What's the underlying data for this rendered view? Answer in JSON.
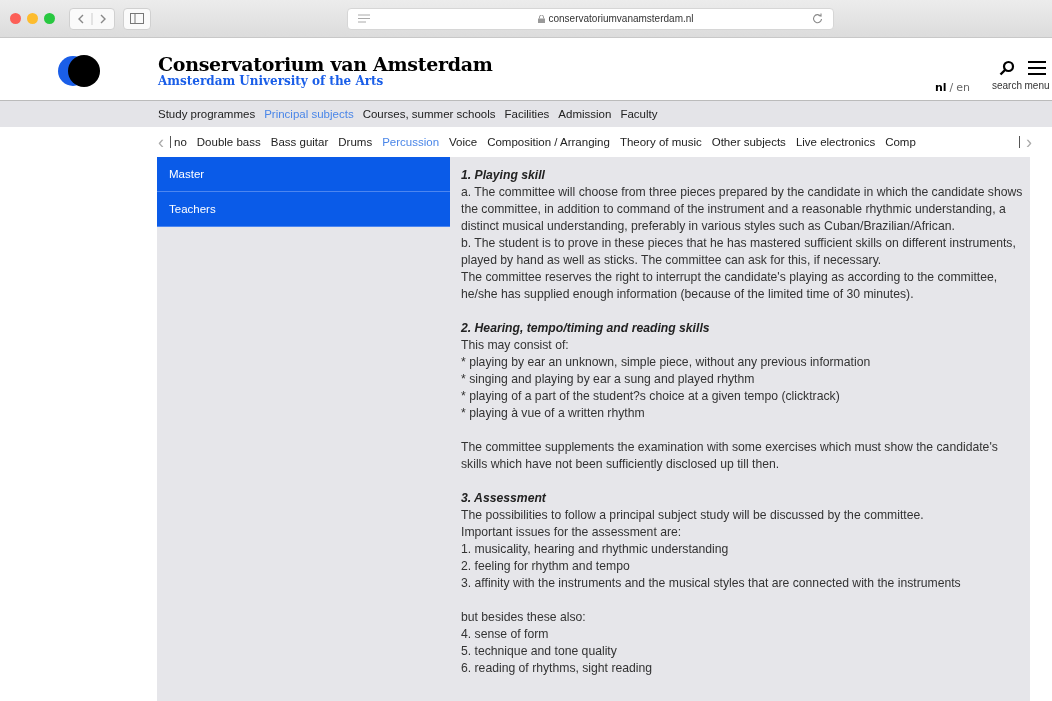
{
  "browser": {
    "url": "conservatoriumvanamsterdam.nl"
  },
  "header": {
    "title": "Conservatorium van Amsterdam",
    "subtitle": "Amsterdam University of the Arts",
    "languages": [
      {
        "label": "nl",
        "selected": true
      },
      {
        "label": "/",
        "selected": false
      },
      {
        "label": "en",
        "selected": false
      }
    ],
    "search_label": "search",
    "menu_label": "menu"
  },
  "nav": [
    {
      "label": "Study programmes",
      "selected": false
    },
    {
      "label": "Principal subjects",
      "selected": true
    },
    {
      "label": "Courses, summer schools",
      "selected": false
    },
    {
      "label": "Facilities",
      "selected": false
    },
    {
      "label": "Admission",
      "selected": false
    },
    {
      "label": "Faculty",
      "selected": false
    }
  ],
  "subjects": {
    "prev": "‹",
    "next": "›",
    "items": [
      {
        "label": "no",
        "selected": false
      },
      {
        "label": "Double bass",
        "selected": false
      },
      {
        "label": "Bass guitar",
        "selected": false
      },
      {
        "label": "Drums",
        "selected": false
      },
      {
        "label": "Percussion",
        "selected": true
      },
      {
        "label": "Voice",
        "selected": false
      },
      {
        "label": "Composition / Arranging",
        "selected": false
      },
      {
        "label": "Theory of music",
        "selected": false
      },
      {
        "label": "Other subjects",
        "selected": false
      },
      {
        "label": "Live electronics",
        "selected": false
      },
      {
        "label": "Comp",
        "selected": false
      }
    ]
  },
  "sidebar": {
    "items": [
      "Master",
      "Teachers"
    ]
  },
  "content": [
    {
      "heading": "1. Playing skill",
      "groups": [
        [
          "a. The committee will choose from three pieces prepared by the candidate in which the candidate shows the committee, in addition to command of the instrument and a reasonable rhythmic understanding, a distinct musical understanding, preferably in various styles such as Cuban/Brazilian/African.",
          "b. The student is to prove in these pieces that he has mastered sufficient skills on different instruments, played by hand as well as sticks. The committee can ask for this, if necessary.",
          "The committee reserves the right to interrupt the candidate's playing as according to the committee, he/she has supplied enough information (because of the limited time of 30 minutes)."
        ]
      ]
    },
    {
      "heading": "2. Hearing, tempo/timing and reading skills",
      "groups": [
        [
          "This may consist of:",
          "* playing by ear an unknown, simple piece, without any previous information",
          "* singing and playing by ear a sung and played rhythm",
          "* playing of a part of the student?s choice at a given tempo (clicktrack)",
          "* playing à vue of  a written rhythm"
        ],
        [
          "The committee supplements the examination with some exercises which must show the candidate's skills which have not been sufficiently disclosed up till then."
        ]
      ]
    },
    {
      "heading": "3. Assessment",
      "groups": [
        [
          "The possibilities to follow a principal subject study will be discussed by the committee.",
          "Important issues for the assessment are:",
          "1. musicality, hearing and rhythmic understanding",
          "2. feeling for rhythm and tempo",
          "3. affinity with the instruments and the musical styles that are connected with the instruments"
        ],
        [
          "but besides these also:",
          "4. sense of form",
          "5. technique and tone quality",
          "6. reading of rhythms, sight reading"
        ]
      ]
    }
  ]
}
